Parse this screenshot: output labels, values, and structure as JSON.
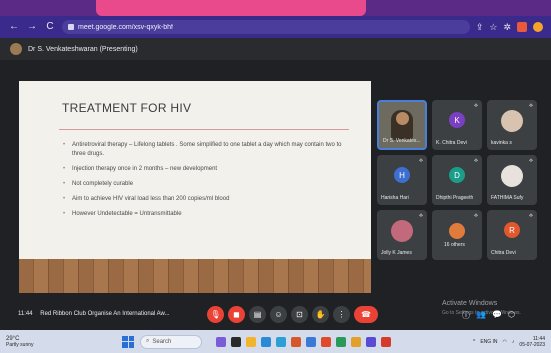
{
  "browser": {
    "url": "meet.google.com/xsv-qxyk-bhf",
    "nav": {
      "back": "←",
      "forward": "→",
      "reload": "C"
    }
  },
  "presenter": {
    "label": "Dr S. Venkateshwaran (Presenting)"
  },
  "slide": {
    "title": "TREATMENT FOR HIV",
    "bullets": [
      "Antiretroviral therapy – Lifelong tablets . Some simplified to one tablet a day which may contain two to three drugs.",
      "Injection therapy once in 2 months – new development",
      "Not completely curable",
      "Aim to achieve HIV viral load less than 200 copies/ml blood",
      "However Undetectable = Untransmittable"
    ]
  },
  "participants": [
    {
      "name": "Dr S. Venkates...",
      "type": "video"
    },
    {
      "name": "K. Chitra Devi",
      "initial": "K",
      "color": "#7b3fc4"
    },
    {
      "name": "kavinka s",
      "type": "photo",
      "color": "#d8c3b0"
    },
    {
      "name": "Harisha Hari",
      "initial": "H",
      "color": "#3d6fd1"
    },
    {
      "name": "Dhipthi Prageeth",
      "initial": "D",
      "color": "#1a9e8a"
    },
    {
      "name": "FATHIMA Sufy",
      "type": "photo",
      "color": "#e7e2dc"
    },
    {
      "name": "Jolly K James",
      "type": "photo",
      "color": "#c26a7c"
    },
    {
      "name": "16 others",
      "type": "others",
      "color": "#e07b3c"
    },
    {
      "name": "Chitra Devi",
      "initial": "R",
      "color": "#e0582b"
    }
  ],
  "controls": {
    "time": "11:44",
    "meeting_title": "Red Ribbon Club Organise An International Aw...",
    "buttons": [
      {
        "name": "mic-off-button",
        "glyph": "🎙",
        "style": "red"
      },
      {
        "name": "camera-off-button",
        "glyph": "◼",
        "style": "red"
      },
      {
        "name": "captions-button",
        "glyph": "▤",
        "style": "grey"
      },
      {
        "name": "emoji-button",
        "glyph": "☺",
        "style": "grey"
      },
      {
        "name": "present-button",
        "glyph": "⊡",
        "style": "grey"
      },
      {
        "name": "raise-hand-button",
        "glyph": "✋",
        "style": "grey"
      },
      {
        "name": "more-options-button",
        "glyph": "⋮",
        "style": "grey"
      },
      {
        "name": "leave-call-button",
        "glyph": "☎",
        "style": "end"
      }
    ],
    "activate_title": "Activate Windows",
    "activate_sub": "Go to Settings to activate Windows.",
    "right_glyphs": [
      "ⓘ",
      "👥",
      "💬",
      "⬡"
    ]
  },
  "taskbar": {
    "temp": "29°C",
    "weather": "Partly sunny",
    "search": "Search",
    "time": "11:44",
    "date": "05-07-2023",
    "lang": "ENG IN"
  },
  "colors": {
    "accent": "#ea4335",
    "meet_bg": "#202124",
    "tile_bg": "#3c4043",
    "browser_bar": "#3a2a8c"
  }
}
